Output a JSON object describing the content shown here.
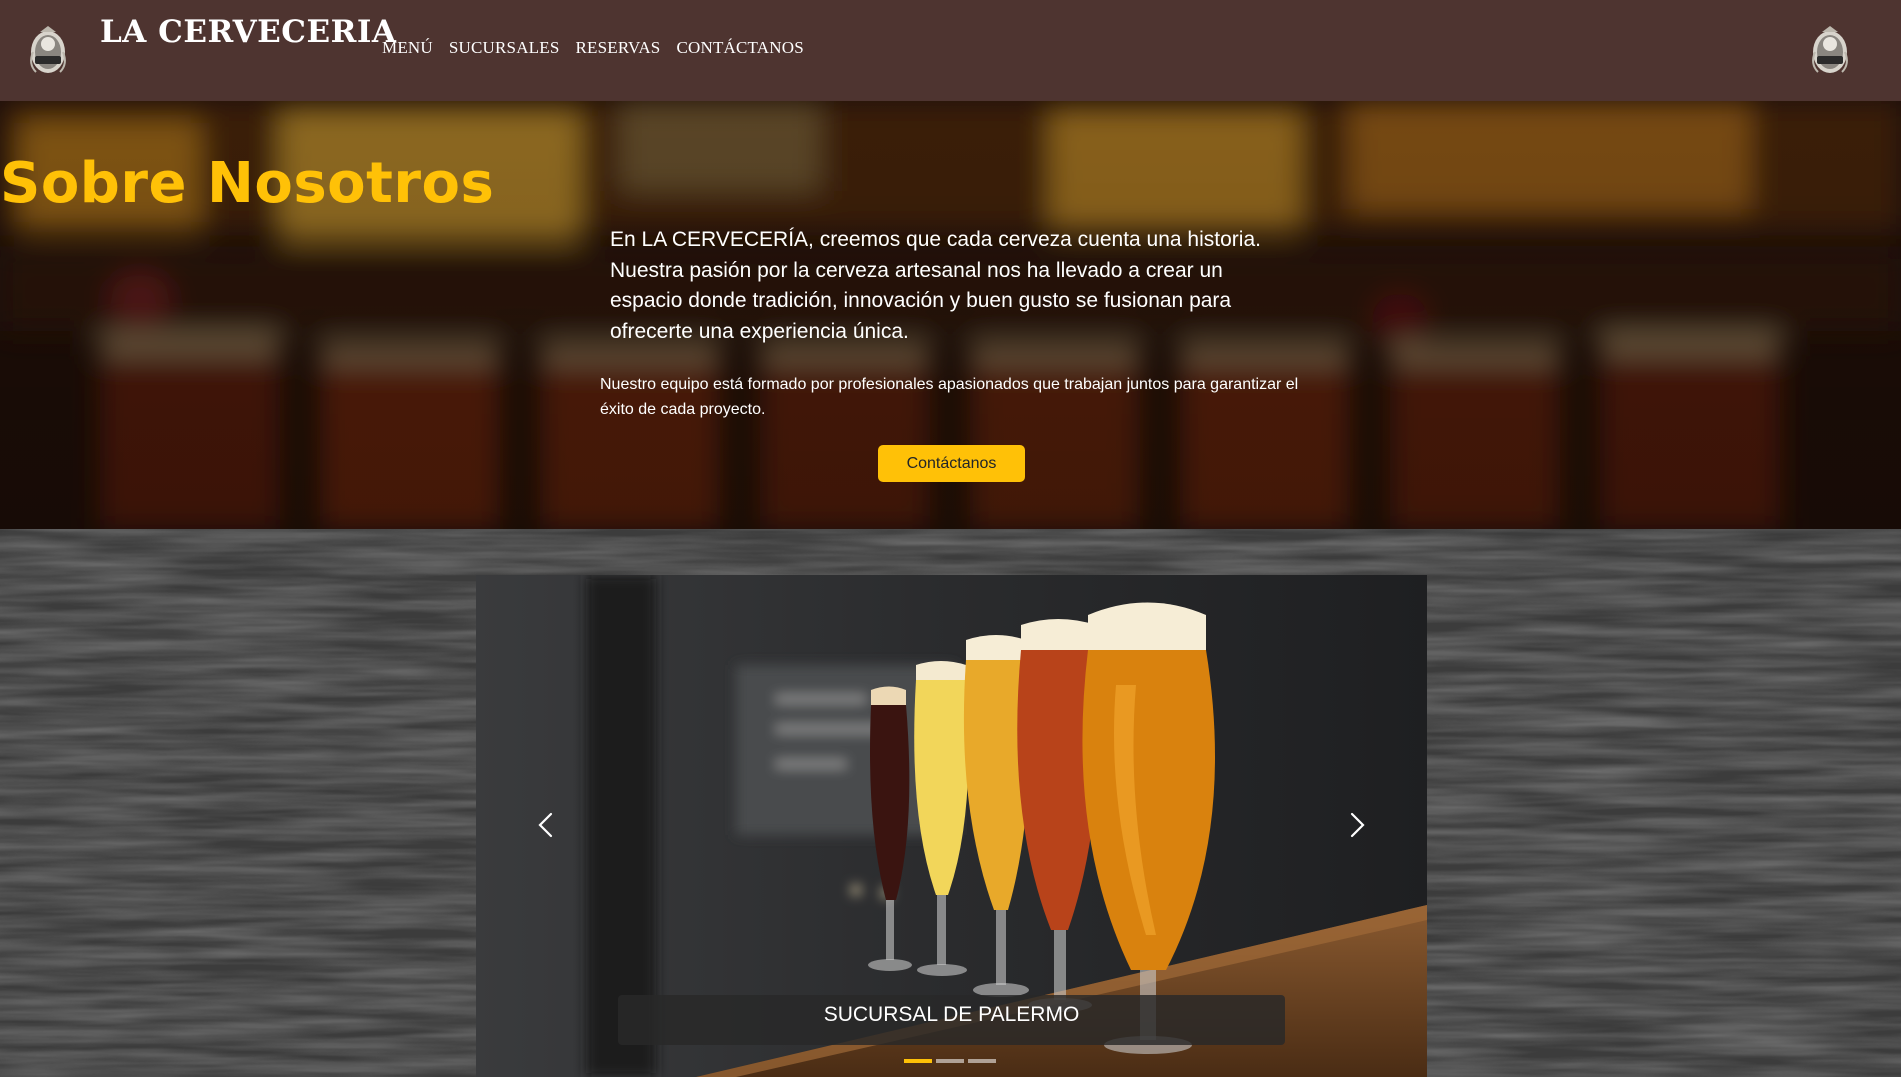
{
  "navbar": {
    "brand": "LA CERVECERIA",
    "logo_icon": "beer-badge-icon",
    "links": [
      "MENÚ",
      "SUCURSALES",
      "RESERVAS",
      "CONTÁCTANOS"
    ],
    "background": "#4e3430"
  },
  "hero": {
    "title": "Sobre Nosotros",
    "lead": "En LA CERVECERÍA, creemos que cada cerveza cuenta una historia. Nuestra pasión por la cerveza artesanal nos ha llevado a crear un espacio donde tradición, innovación y buen gusto se fusionan para ofrecerte una experiencia única.",
    "small": "Nuestro equipo está formado por profesionales apasionados que trabajan juntos para garantizar el éxito de cada proyecto.",
    "button": "Contáctanos",
    "accent": "#ffc107"
  },
  "carousel": {
    "caption": "SUCURSAL DE PALERMO",
    "prev_icon": "chevron-left-icon",
    "next_icon": "chevron-right-icon",
    "slide_count": 3,
    "active_index": 0,
    "beer_colors": [
      "#3a1410",
      "#f2d65a",
      "#e8a92a",
      "#b8431a",
      "#d9820e"
    ]
  }
}
